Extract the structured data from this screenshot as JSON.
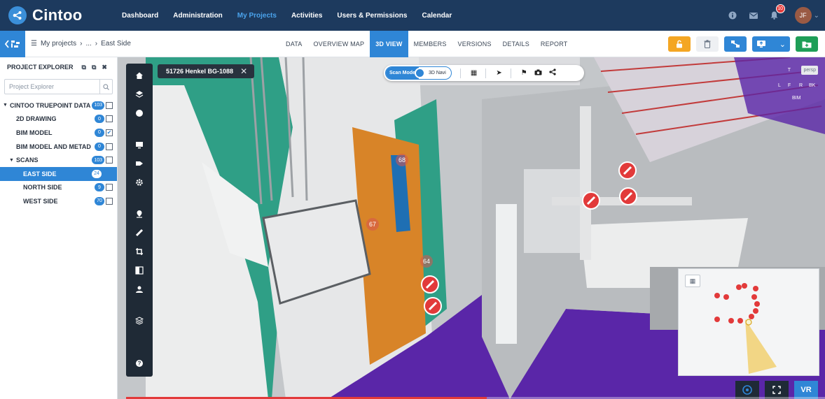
{
  "app": {
    "name": "Cintoo"
  },
  "nav": {
    "items": [
      "Dashboard",
      "Administration",
      "My Projects",
      "Activities",
      "Users & Permissions",
      "Calendar"
    ],
    "active": "My Projects"
  },
  "user": {
    "initials": "JF",
    "notifications": "10"
  },
  "breadcrumb": {
    "root": "My projects",
    "ellipsis": "...",
    "current": "East Side"
  },
  "tabs": [
    {
      "label": "DATA",
      "active": false
    },
    {
      "label": "OVERVIEW MAP",
      "active": false
    },
    {
      "label": "3D VIEW",
      "active": true
    },
    {
      "label": "MEMBERS",
      "active": false
    },
    {
      "label": "VERSIONS",
      "active": false
    },
    {
      "label": "DETAILS",
      "active": false
    },
    {
      "label": "REPORT",
      "active": false
    }
  ],
  "explorer": {
    "title": "PROJECT EXPLORER",
    "search_placeholder": "Project Explorer",
    "tree": [
      {
        "label": "CINTOO TRUEPOINT DATA",
        "count": "103",
        "checked": false,
        "level": 0,
        "expanded": true
      },
      {
        "label": "2D DRAWING",
        "count": "0",
        "checked": false,
        "level": 1
      },
      {
        "label": "BIM MODEL",
        "count": "0",
        "checked": true,
        "level": 1
      },
      {
        "label": "BIM MODEL AND METAD",
        "count": "0",
        "checked": false,
        "level": 1
      },
      {
        "label": "SCANS",
        "count": "103",
        "checked": false,
        "level": 1,
        "expanded": true
      },
      {
        "label": "EAST SIDE",
        "count": "24",
        "checked": null,
        "level": 2,
        "selected": true
      },
      {
        "label": "NORTH SIDE",
        "count": "9",
        "checked": false,
        "level": 2
      },
      {
        "label": "WEST SIDE",
        "count": "70",
        "checked": false,
        "level": 2
      }
    ]
  },
  "viewer": {
    "scan_name": "51726 Henkel BG-1088",
    "mode_scan": "Scan Mode",
    "mode_navi": "3D Navi",
    "scan_markers": [
      "68",
      "67",
      "64"
    ],
    "cube_labels": {
      "top": "T",
      "persp": "persp",
      "left": "L",
      "front": "F",
      "right": "R",
      "back": "BK",
      "bim": "BIM"
    },
    "vr_label": "VR"
  },
  "colors": {
    "nav_bg": "#1d3a5e",
    "accent": "#2f86d6",
    "orange": "#f4a623",
    "green": "#1e9e57",
    "marker_red": "#e23a3a",
    "wall_teal": "#2f9f86",
    "floor_purple": "#5a26a8"
  }
}
